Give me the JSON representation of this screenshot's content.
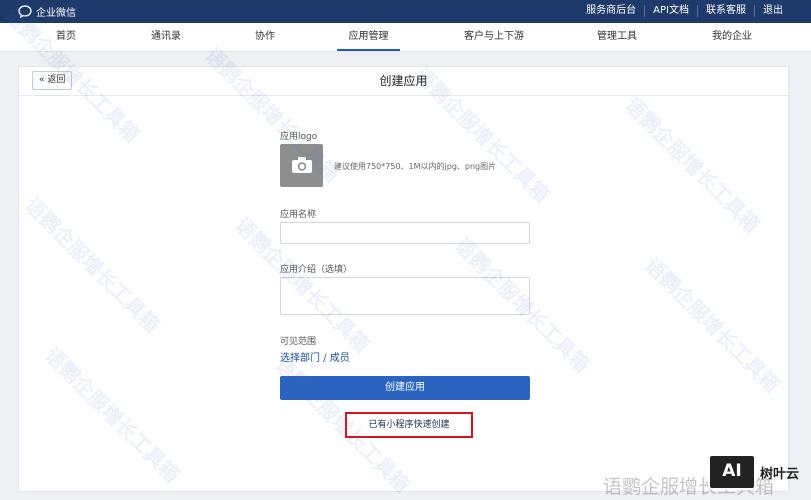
{
  "topbar": {
    "brand": "企业微信",
    "links": [
      "服务商后台",
      "API文档",
      "联系客服",
      "退出"
    ]
  },
  "nav": {
    "tabs": [
      {
        "label": "首页",
        "active": false
      },
      {
        "label": "通讯录",
        "active": false
      },
      {
        "label": "协作",
        "active": false
      },
      {
        "label": "应用管理",
        "active": true
      },
      {
        "label": "客户与上下游",
        "active": false
      },
      {
        "label": "管理工具",
        "active": false
      },
      {
        "label": "我的企业",
        "active": false
      }
    ]
  },
  "panel": {
    "back_label": "返回",
    "title": "创建应用"
  },
  "form": {
    "logo_label": "应用logo",
    "logo_hint": "建议使用750*750、1M以内的jpg、png图片",
    "name_label": "应用名称",
    "name_value": "",
    "intro_label": "应用介绍（选填）",
    "intro_value": "",
    "scope_label": "可见范围",
    "scope_link": "选择部门 / 成员",
    "create_button": "创建应用",
    "mini_program_button": "已有小程序快速创建"
  },
  "watermark": {
    "text": "语鹦企服增长工具箱"
  },
  "badge": {
    "logo_text": "AI",
    "name": "树叶云"
  },
  "colors": {
    "topbar": "#1e3a6b",
    "primary": "#2a64c0",
    "highlight_border": "#d6141b"
  }
}
